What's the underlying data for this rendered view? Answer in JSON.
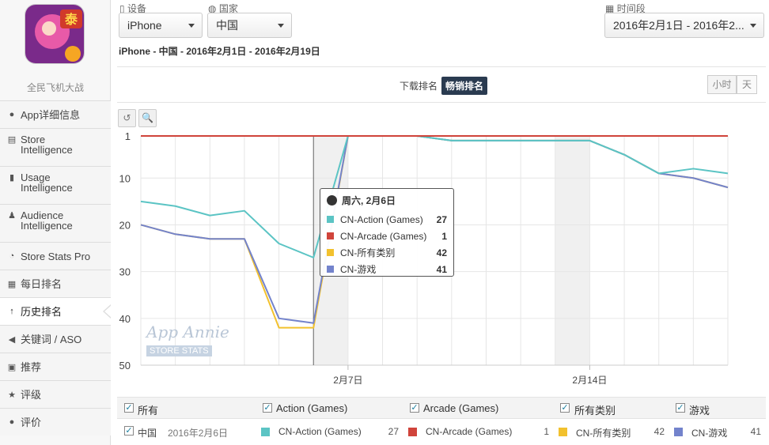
{
  "app": {
    "name": "全民飞机大战"
  },
  "sidebar": {
    "items": [
      {
        "icon": "info-icon",
        "label": "App详细信息"
      },
      {
        "icon": "store-icon",
        "label": "Store\nIntelligence"
      },
      {
        "icon": "usage-icon",
        "label": "Usage\nIntelligence"
      },
      {
        "icon": "person-icon",
        "label": "Audience\nIntelligence"
      },
      {
        "icon": "gauge-icon",
        "label": "Store Stats Pro"
      },
      {
        "icon": "calendar-icon",
        "label": "每日排名"
      },
      {
        "icon": "arrow-up-icon",
        "label": "历史排名"
      },
      {
        "icon": "megaphone-icon",
        "label": "关键词 / ASO"
      },
      {
        "icon": "book-icon",
        "label": "推荐"
      },
      {
        "icon": "star-icon",
        "label": "评级"
      },
      {
        "icon": "comment-icon",
        "label": "评价"
      }
    ]
  },
  "filters": {
    "device_label": "设备",
    "device_value": "iPhone",
    "country_label": "国家",
    "country_value": "中国",
    "date_label": "时间段",
    "date_value": "2016年2月1日 - 2016年2..."
  },
  "subtitle": "iPhone - 中国 - 2016年2月1日 - 2016年2月19日",
  "rank_toggle": {
    "download": "下载排名",
    "grossing": "畅销排名"
  },
  "granularity": {
    "hour": "小时",
    "day": "天"
  },
  "tools": {
    "reset": "↺",
    "zoom": "🔍"
  },
  "watermark": {
    "brand": "App Annie",
    "sub": "STORE STATS"
  },
  "tooltip": {
    "title": "周六, 2月6日",
    "rows": [
      {
        "name": "CN-Action (Games)",
        "value": "27",
        "color": "#5bc4c4"
      },
      {
        "name": "CN-Arcade (Games)",
        "value": "1",
        "color": "#d0443b"
      },
      {
        "name": "CN-所有类别",
        "value": "42",
        "color": "#f2c12e"
      },
      {
        "name": "CN-游戏",
        "value": "41",
        "color": "#7383cc"
      }
    ]
  },
  "legend": {
    "all": "所有",
    "action": "Action (Games)",
    "arcade": "Arcade (Games)",
    "overall": "所有类别",
    "games": "游戏"
  },
  "detail_row": {
    "country": "中国",
    "date": "2016年2月6日",
    "action_name": "CN-Action (Games)",
    "action_value": "27",
    "arcade_name": "CN-Arcade (Games)",
    "arcade_value": "1",
    "overall_name": "CN-所有类别",
    "overall_value": "42",
    "games_name": "CN-游戏",
    "games_value": "41"
  },
  "chart_data": {
    "type": "line",
    "title": "",
    "xlabel": "",
    "ylabel": "",
    "y_reversed": true,
    "ylim": [
      1,
      50
    ],
    "yticks": [
      1,
      10,
      20,
      30,
      40,
      50
    ],
    "x": [
      "2016-02-01",
      "2016-02-02",
      "2016-02-03",
      "2016-02-04",
      "2016-02-05",
      "2016-02-06",
      "2016-02-07",
      "2016-02-08",
      "2016-02-09",
      "2016-02-10",
      "2016-02-11",
      "2016-02-12",
      "2016-02-13",
      "2016-02-14",
      "2016-02-15",
      "2016-02-16",
      "2016-02-17",
      "2016-02-18"
    ],
    "xtick_labels": [
      {
        "date": "2016-02-07",
        "label": "2月7日"
      },
      {
        "date": "2016-02-14",
        "label": "2月14日"
      }
    ],
    "series": [
      {
        "name": "CN-Action (Games)",
        "color": "#5bc4c4",
        "values": [
          15,
          16,
          18,
          17,
          24,
          27,
          1,
          1,
          1,
          2,
          2,
          2,
          2,
          2,
          5,
          9,
          8,
          9
        ]
      },
      {
        "name": "CN-Arcade (Games)",
        "color": "#d0443b",
        "values": [
          1,
          1,
          1,
          1,
          1,
          1,
          1,
          1,
          1,
          1,
          1,
          1,
          1,
          1,
          1,
          1,
          1,
          1
        ]
      },
      {
        "name": "CN-所有类别",
        "color": "#f2c12e",
        "values": [
          20,
          22,
          23,
          23,
          42,
          42,
          1,
          1,
          1,
          2,
          2,
          2,
          2,
          2,
          5,
          9,
          10,
          12
        ]
      },
      {
        "name": "CN-游戏",
        "color": "#7383cc",
        "values": [
          20,
          22,
          23,
          23,
          40,
          41,
          1,
          1,
          1,
          2,
          2,
          2,
          2,
          2,
          5,
          9,
          10,
          12
        ]
      }
    ],
    "hover_date": "2016-02-06",
    "weekend_bands": [
      [
        "2016-02-06",
        "2016-02-07"
      ],
      [
        "2016-02-13",
        "2016-02-14"
      ]
    ],
    "grid": true
  }
}
